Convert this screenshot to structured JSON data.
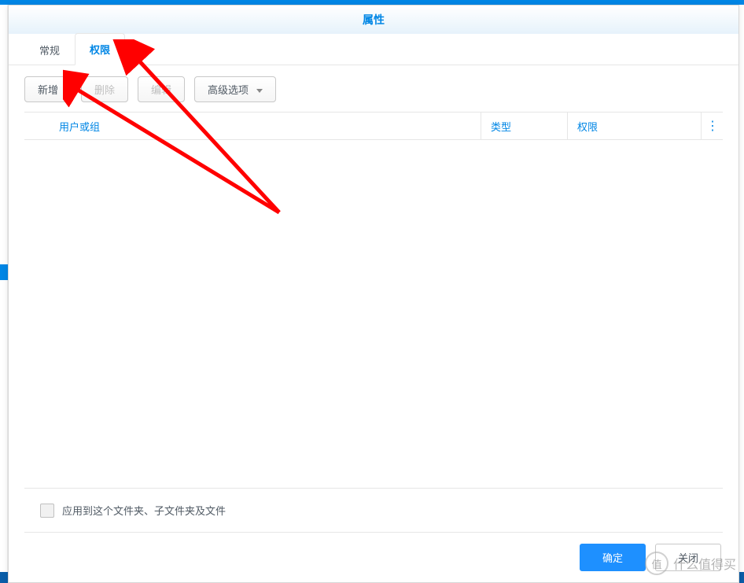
{
  "dialog": {
    "title": "属性"
  },
  "tabs": {
    "general": "常规",
    "permission": "权限"
  },
  "toolbar": {
    "add": "新增",
    "delete": "删除",
    "edit": "编辑",
    "advanced": "高级选项"
  },
  "table": {
    "userGroup": "用户或组",
    "type": "类型",
    "permission": "权限"
  },
  "footer": {
    "applyRecursive": "应用到这个文件夹、子文件夹及文件",
    "ok": "确定",
    "close": "关闭"
  },
  "watermark": {
    "logo": "值",
    "text": "什么值得买"
  }
}
